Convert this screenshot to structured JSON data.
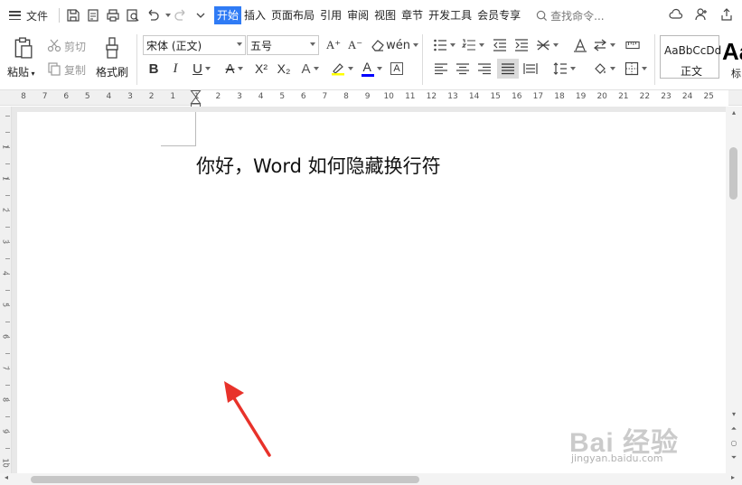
{
  "menubar": {
    "file_label": "文件",
    "tabs": [
      "开始",
      "插入",
      "页面布局",
      "引用",
      "审阅",
      "视图",
      "章节",
      "开发工具",
      "会员专享"
    ],
    "active_tab": "开始",
    "search_placeholder": "查找命令..."
  },
  "ribbon": {
    "paste_label": "粘贴",
    "cut_label": "剪切",
    "copy_label": "复制",
    "format_painter_label": "格式刷",
    "font_name": "宋体 (正文)",
    "font_size": "五号",
    "style_normal_sample": "AaBbCcDd",
    "style_normal_name": "正文",
    "style_heading_sample": "Aa",
    "style_heading_name": "标",
    "bold_glyph": "B",
    "italic_glyph": "I",
    "underline_glyph": "U",
    "font_color": "#0000ff",
    "highlight_color": "#ffff00",
    "superscript_glyph": "X²",
    "subscript_glyph": "X₂",
    "grow_glyph": "A⁺",
    "shrink_glyph": "A⁻",
    "strike_glyph": "A",
    "shade_glyph": "A",
    "textbox_glyph": "A"
  },
  "ruler": {
    "numbers": [
      "8",
      "7",
      "6",
      "5",
      "4",
      "3",
      "2",
      "1",
      "1",
      "2",
      "3",
      "4",
      "5",
      "6",
      "7",
      "8",
      "9",
      "10",
      "11",
      "12",
      "13",
      "14",
      "15",
      "16",
      "17",
      "18",
      "19",
      "20",
      "21",
      "22",
      "23",
      "24",
      "25"
    ],
    "vertical_numbers": [
      "1",
      "1",
      "2",
      "3",
      "4",
      "5",
      "6",
      "7",
      "8",
      "9",
      "10"
    ]
  },
  "document": {
    "text": "你好，Word 如何隐藏换行符"
  },
  "watermark": {
    "main": "Bai 经验",
    "sub": "jingyan.baidu.com"
  },
  "colors": {
    "accent": "#2f7bf5",
    "arrow": "#e8322a"
  }
}
